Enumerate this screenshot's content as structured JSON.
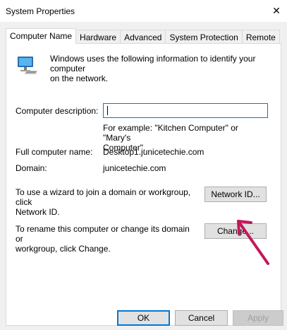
{
  "window": {
    "title": "System Properties",
    "close_glyph": "✕"
  },
  "tabs": [
    {
      "label": "Computer Name",
      "active": true
    },
    {
      "label": "Hardware",
      "active": false
    },
    {
      "label": "Advanced",
      "active": false
    },
    {
      "label": "System Protection",
      "active": false
    },
    {
      "label": "Remote",
      "active": false
    }
  ],
  "computer_name": {
    "intro_line1": "Windows uses the following information to identify your computer",
    "intro_line2": "on the network.",
    "description_label": "Computer description:",
    "description_value": "",
    "example_line1": "For example: \"Kitchen Computer\" or \"Mary's",
    "example_line2": "Computer\".",
    "full_name_label": "Full computer name:",
    "full_name_value": "Desktop1.junicetechie.com",
    "domain_label": "Domain:",
    "domain_value": "junicetechie.com",
    "wizard_line1": "To use a wizard to join a domain or workgroup, click",
    "wizard_line2": "Network ID.",
    "network_id_button": "Network ID...",
    "rename_line1": "To rename this computer or change its domain or",
    "rename_line2": "workgroup, click Change.",
    "change_button": "Change..."
  },
  "footer": {
    "ok": "OK",
    "cancel": "Cancel",
    "apply": "Apply"
  },
  "colors": {
    "focus_blue": "#0078d7",
    "arrow": "#c2185b",
    "dialog_bg": "#f0f0f0"
  },
  "icons": {
    "close": "close-icon",
    "computer": "computer-monitor-icon",
    "annotation": "annotation-arrow-icon"
  }
}
